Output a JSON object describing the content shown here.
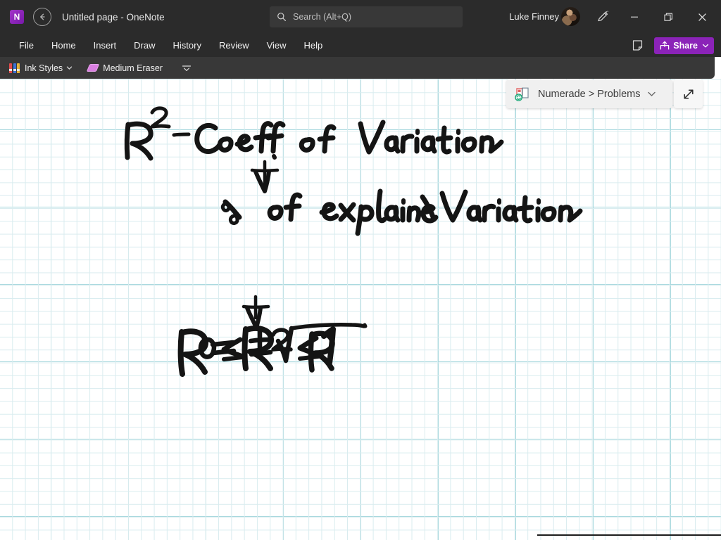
{
  "window": {
    "app_name": "OneNote",
    "page_title": "Untitled page",
    "title_separator": "-",
    "full_title": "Untitled page  -  OneNote",
    "logo_letter": "N",
    "accent_color": "#7719aa",
    "titlebar_color": "#2b2b2b"
  },
  "titlebar": {
    "back_button": "Back",
    "search": {
      "placeholder": "Search (Alt+Q)",
      "value": ""
    },
    "account": {
      "user_name": "Luke Finney"
    },
    "pen_button_label": "Draw with touch",
    "window_controls": {
      "minimize": "Minimize",
      "restore": "Restore",
      "close": "Close"
    }
  },
  "menubar": {
    "items": [
      {
        "label": "File"
      },
      {
        "label": "Home"
      },
      {
        "label": "Insert"
      },
      {
        "label": "Draw"
      },
      {
        "label": "History"
      },
      {
        "label": "Review"
      },
      {
        "label": "View"
      },
      {
        "label": "Help"
      }
    ],
    "notes_button_label": "Notes",
    "share": {
      "label": "Share",
      "color": "#8b23b8"
    }
  },
  "drawbar": {
    "ink_styles": {
      "label": "Ink Styles",
      "pen_colors": [
        "#e04b4b",
        "#3b6fd4",
        "#e2b13a"
      ]
    },
    "eraser": {
      "label": "Medium Eraser",
      "color": "#d97fe0"
    },
    "more_label": "More options"
  },
  "numerade_panel": {
    "breadcrumb": "Numerade > Problems",
    "parent": "Numerade",
    "child": "Problems",
    "separator": ">",
    "icon": "numerade-sync-icon",
    "collapse_label": "Collapse",
    "expand_label": "Expand"
  },
  "canvas": {
    "grid_minor_color": "#d9ecef",
    "grid_major_color": "#a8d8de",
    "background_color": "#ffffff",
    "ink_color": "#141414",
    "handwritten_notes": [
      {
        "id": "line-1",
        "text": "R² - Coeff. of Variation"
      },
      {
        "id": "arrow-1",
        "text": "↓"
      },
      {
        "id": "line-2",
        "text": "% of explained Variation"
      },
      {
        "id": "line-3",
        "text": "0 ≤ R² ≤ 1"
      },
      {
        "id": "arrow-2",
        "text": "↓"
      },
      {
        "id": "line-4",
        "text": "R = ± √R"
      }
    ]
  }
}
